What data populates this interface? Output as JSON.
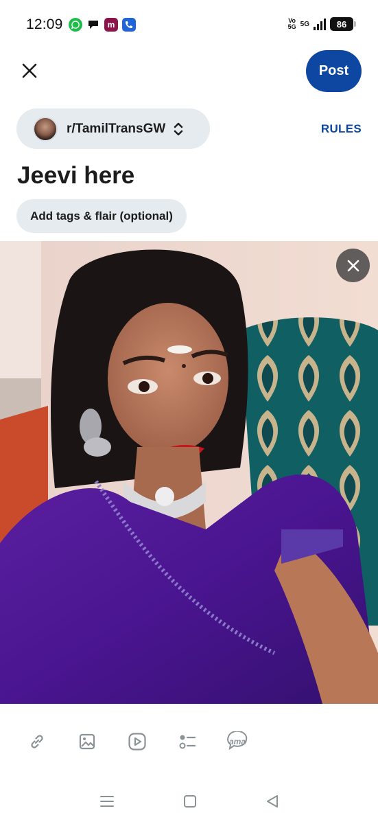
{
  "status_bar": {
    "time": "12:09",
    "notification_icons": [
      "whatsapp-icon",
      "chat-bubble-icon",
      "m-app-icon",
      "phone-app-icon"
    ],
    "volte_line1": "Vo",
    "volte_line2": "5G",
    "network": "5G",
    "battery": "86"
  },
  "header": {
    "post_label": "Post"
  },
  "community": {
    "name": "r/TamilTransGW",
    "rules_label": "RULES"
  },
  "post": {
    "title": "Jeevi here",
    "tags_label": "Add tags & flair (optional)"
  },
  "toolbar": {
    "ama_label": "ama"
  },
  "colors": {
    "accent": "#0d47a1",
    "chip_bg": "#e5ebee",
    "toolbar_icon": "#8a9296"
  }
}
